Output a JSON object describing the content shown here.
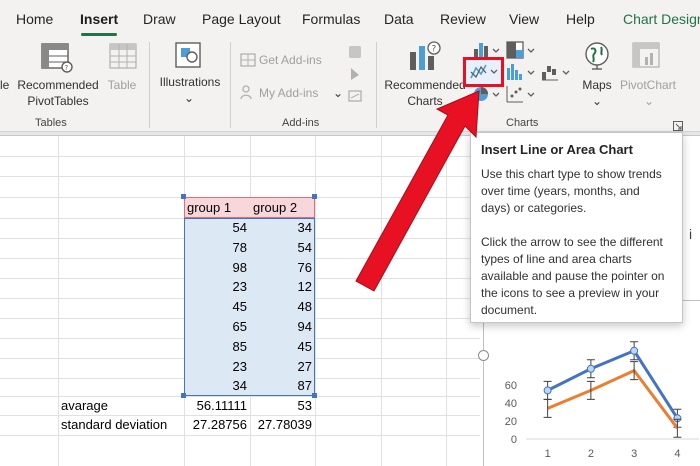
{
  "tabs": [
    {
      "label": "Home"
    },
    {
      "label": "Insert"
    },
    {
      "label": "Draw"
    },
    {
      "label": "Page Layout"
    },
    {
      "label": "Formulas"
    },
    {
      "label": "Data"
    },
    {
      "label": "Review"
    },
    {
      "label": "View"
    },
    {
      "label": "Help"
    },
    {
      "label": "Chart Design"
    }
  ],
  "ribbon": {
    "tables": {
      "cut_label": "le",
      "recommended_pivot_line1": "Recommended",
      "recommended_pivot_line2": "PivotTables",
      "table_label": "Table",
      "group_label": "Tables"
    },
    "illustrations": {
      "label": "Illustrations"
    },
    "addins": {
      "get_addins": "Get Add-ins",
      "my_addins": "My Add-ins",
      "group_label": "Add-ins"
    },
    "charts": {
      "recommended_line1": "Recommended",
      "recommended_line2": "Charts",
      "maps_label": "Maps",
      "pivotchart_label": "PivotChart",
      "group_label": "Charts"
    }
  },
  "sheet": {
    "headers": [
      "group 1",
      "group 2"
    ],
    "group1": [
      "54",
      "78",
      "98",
      "23",
      "45",
      "65",
      "85",
      "23",
      "34"
    ],
    "group2": [
      "34",
      "54",
      "76",
      "12",
      "48",
      "94",
      "45",
      "27",
      "87"
    ],
    "summary": [
      {
        "label": "avarage",
        "g1": "56.11111",
        "g2": "53"
      },
      {
        "label": "standard deviation",
        "g1": "27.28756",
        "g2": "27.78039"
      }
    ]
  },
  "tooltip": {
    "title": "Insert Line or Area Chart",
    "body1": "Use this chart type to show trends over time (years, months, and days) or categories.",
    "body2": "Click the arrow to see the different types of line and area charts available and pause the pointer on the icons to see a preview in your document."
  },
  "chart": {
    "yticks": [
      "60",
      "40",
      "20",
      "0"
    ],
    "xticks": [
      "1",
      "2",
      "3",
      "4"
    ],
    "cut_letter": "i"
  },
  "colors": {
    "accent": "#217346",
    "highlight_box": "#e81123",
    "arrow": "#e81123",
    "series_blue": "#4472c4",
    "series_orange": "#ed7d31"
  },
  "chart_data": {
    "type": "line",
    "x": [
      1,
      2,
      3,
      4
    ],
    "series": [
      {
        "values": [
          54,
          78,
          98,
          23
        ]
      },
      {
        "values": [
          34,
          54,
          76,
          12
        ]
      }
    ],
    "error_bars": true,
    "ylim": [
      0,
      100
    ],
    "xlim": [
      0.5,
      4.5
    ],
    "yticks": [
      0,
      20,
      40,
      60
    ],
    "xticks": [
      1,
      2,
      3,
      4
    ],
    "grid": false,
    "legend": "none",
    "title": "",
    "xlabel": "",
    "ylabel": ""
  }
}
